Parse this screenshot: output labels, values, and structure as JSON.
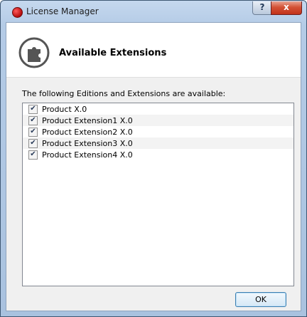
{
  "window": {
    "title": "License Manager",
    "help_glyph": "?",
    "close_glyph": "x"
  },
  "header": {
    "heading": "Available Extensions",
    "icon": "puzzle-icon"
  },
  "intro_text": "The following Editions and Extensions are available:",
  "extensions": [
    {
      "label": "Product X.0",
      "checked": true
    },
    {
      "label": "Product Extension1 X.0",
      "checked": true
    },
    {
      "label": "Product Extension2 X.0",
      "checked": true
    },
    {
      "label": "Product Extension3 X.0",
      "checked": true
    },
    {
      "label": "Product Extension4 X.0",
      "checked": true
    }
  ],
  "buttons": {
    "ok": "OK"
  },
  "colors": {
    "app_icon": "#c81e1e",
    "close_button": "#c8412a",
    "frame": "#b4cbe6"
  }
}
